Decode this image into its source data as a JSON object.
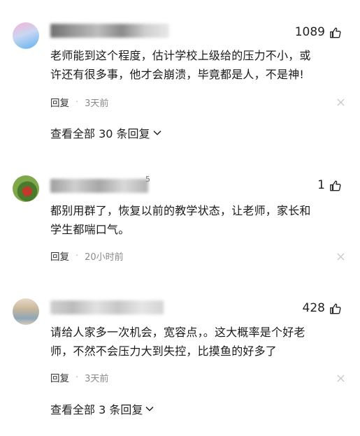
{
  "comments": [
    {
      "likes": "1089",
      "text_line1": "老师能到这个程度，估计学校上级给的压力不小，或",
      "text_line2": "许还有很多事，他才会崩溃，毕竟都是人，不是神!",
      "reply_label": "回复",
      "separator": "·",
      "time": "3天前",
      "more_replies": "查看全部 30 条回复"
    },
    {
      "likes": "1",
      "text_line1": "都别用群了，恢复以前的教学状态，让老师，家长和",
      "text_line2": "学生都喘口气。",
      "reply_label": "回复",
      "separator": "·",
      "time": "20小时前"
    },
    {
      "likes": "428",
      "text_line1": "请给人家多一次机会，宽容点，。这大概率是个好老",
      "text_line2": "师，不然不会压力大到失控，比摸鱼的好多了",
      "reply_label": "回复",
      "separator": "·",
      "time": "3天前",
      "more_replies": "查看全部 3 条回复"
    }
  ],
  "icons": {
    "like": "thumbs-up-icon",
    "close": "close-icon",
    "chevron": "chevron-down-icon"
  },
  "colors": {
    "meta_gray": "#8a8a8a",
    "text": "#1a1a1a"
  }
}
